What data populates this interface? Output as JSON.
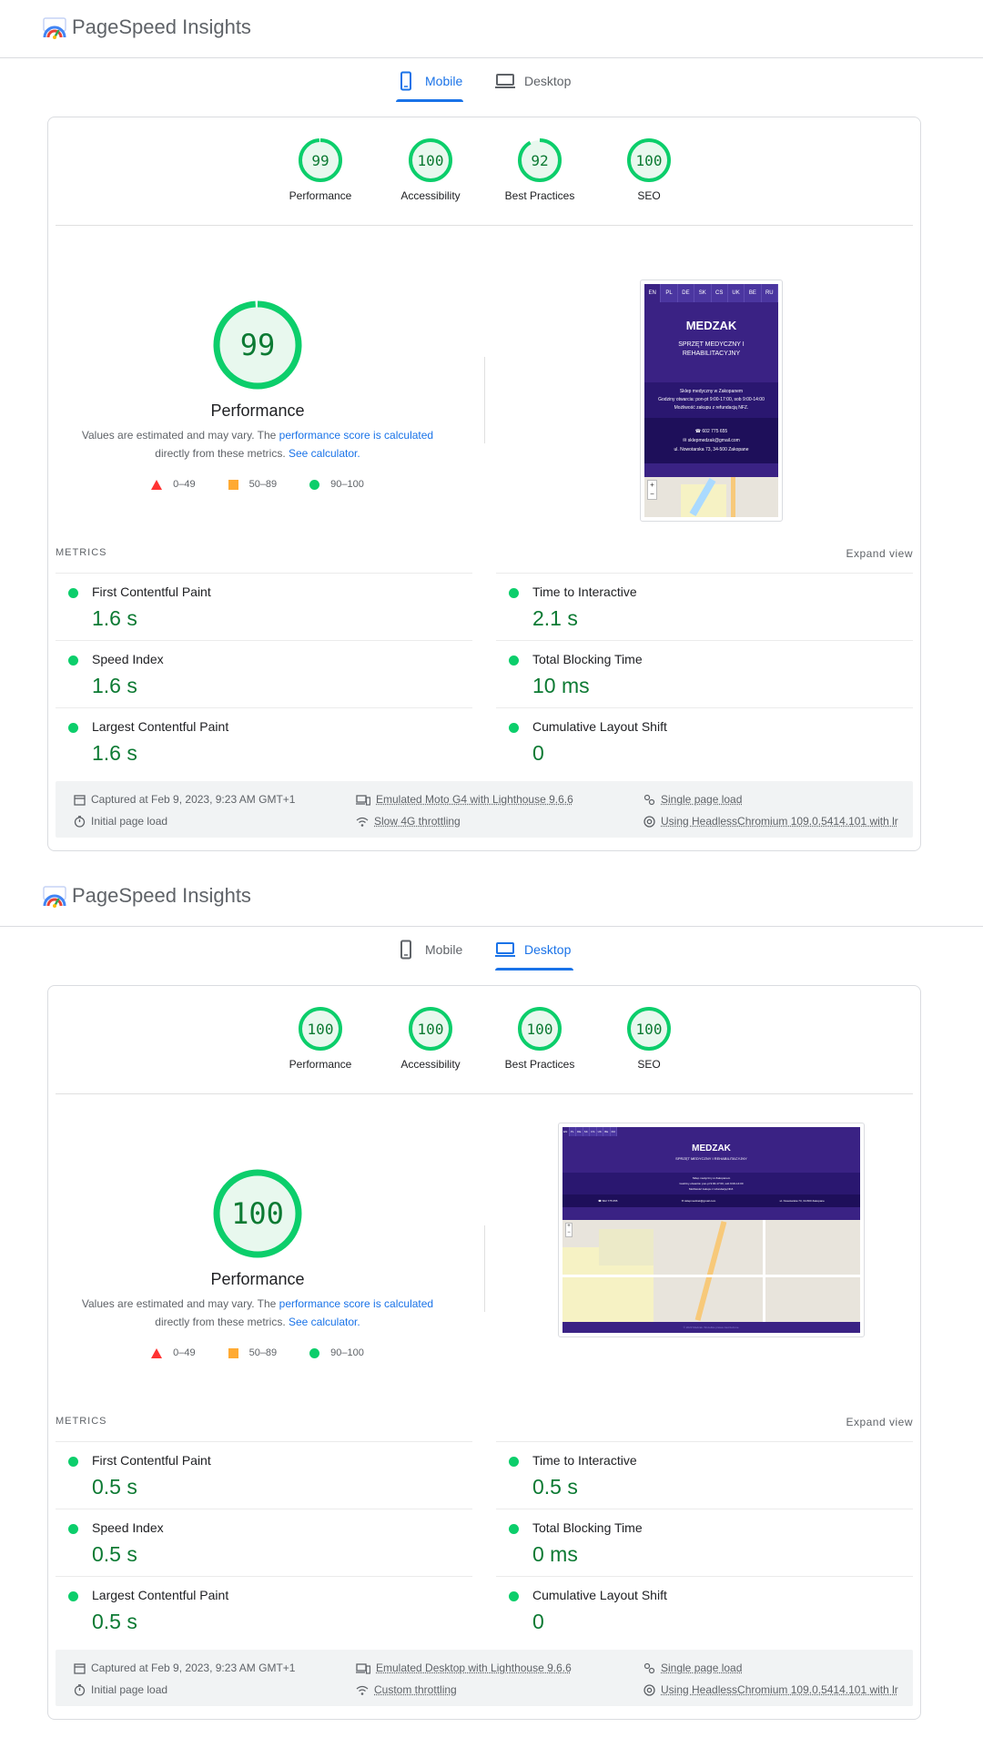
{
  "app_title": "PageSpeed Insights",
  "tabs": {
    "mobile": "Mobile",
    "desktop": "Desktop"
  },
  "categories": [
    "Performance",
    "Accessibility",
    "Best Practices",
    "SEO"
  ],
  "perf": {
    "title": "Performance",
    "note_prefix": "Values are estimated and may vary. The ",
    "note_link1": "performance score is calculated",
    "note_mid": "directly from these metrics. ",
    "note_link2": "See calculator."
  },
  "legend": [
    "0–49",
    "50–89",
    "90–100"
  ],
  "metrics_header": "METRICS",
  "expand_view": "Expand view",
  "metric_names": {
    "fcp": "First Contentful Paint",
    "tti": "Time to Interactive",
    "si": "Speed Index",
    "tbt": "Total Blocking Time",
    "lcp": "Largest Contentful Paint",
    "cls": "Cumulative Layout Shift"
  },
  "site": {
    "langs": [
      "EN",
      "PL",
      "DE",
      "SK",
      "CS",
      "UK",
      "BE",
      "RU"
    ],
    "brand": "MEDZAK",
    "tagline": "SPRZĘT MEDYCZNY I REHABILITACYJNY",
    "info1": "Sklep medyczny w Zakopanem",
    "info2": "Godziny otwarcia: pon-pt 9:00-17:00, sob 9:00-14:00",
    "info3": "Możliwość zakupu z refundacją NFZ.",
    "phone": "☎ 602 775 655",
    "email": "✉ sklepmedzak@gmail.com",
    "address": "ul. Nowotarska 73, 34-500 Zakopane",
    "copyright": "© 2023 Medzak. Wszelkie prawa zastrzeżone."
  },
  "mobile": {
    "scores": [
      99,
      100,
      92,
      100
    ],
    "perf_score": 99,
    "metrics": {
      "fcp": "1.6 s",
      "tti": "2.1 s",
      "si": "1.6 s",
      "tbt": "10 ms",
      "lcp": "1.6 s",
      "cls": "0"
    },
    "footer": {
      "captured": "Captured at Feb 9, 2023, 9:23 AM GMT+1",
      "initial": "Initial page load",
      "device": "Emulated Moto G4 with Lighthouse 9.6.6",
      "throttle": "Slow 4G throttling",
      "single": "Single page load",
      "browser": "Using HeadlessChromium 109.0.5414.101 with lr"
    }
  },
  "desktop": {
    "scores": [
      100,
      100,
      100,
      100
    ],
    "perf_score": 100,
    "metrics": {
      "fcp": "0.5 s",
      "tti": "0.5 s",
      "si": "0.5 s",
      "tbt": "0 ms",
      "lcp": "0.5 s",
      "cls": "0"
    },
    "footer": {
      "captured": "Captured at Feb 9, 2023, 9:23 AM GMT+1",
      "initial": "Initial page load",
      "device": "Emulated Desktop with Lighthouse 9.6.6",
      "throttle": "Custom throttling",
      "single": "Single page load",
      "browser": "Using HeadlessChromium 109.0.5414.101 with lr"
    }
  },
  "colors": {
    "pass": "#0cce6b",
    "pass_text": "#0c7a33",
    "pass_bg": "#e8f8ee",
    "average": "#ffaa33",
    "fail": "#ff3333",
    "accent": "#1a73e8"
  }
}
